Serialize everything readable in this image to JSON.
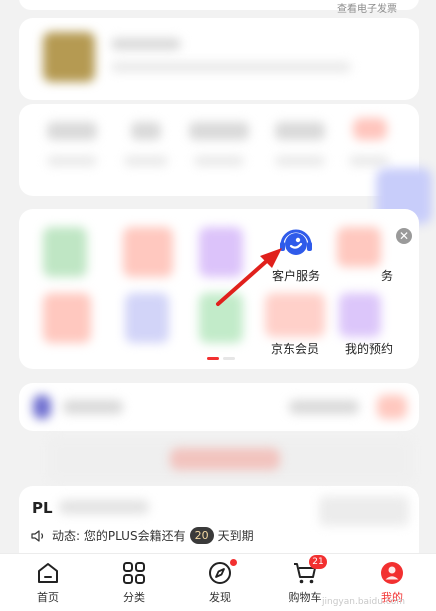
{
  "header": {
    "invoice_link": "查看电子发票"
  },
  "services": {
    "customer_service_label": "客户服务",
    "item_partial_right": "务",
    "vip_label": "京东会员",
    "reservation_label": "我的预约",
    "close_symbol": "✕"
  },
  "plus": {
    "title": "PL",
    "notice_prefix": "动态: 您的PLUS会籍还有",
    "days": "20",
    "notice_suffix": "天到期"
  },
  "tabbar": {
    "items": [
      {
        "label": "首页",
        "icon": "home-icon"
      },
      {
        "label": "分类",
        "icon": "grid-icon"
      },
      {
        "label": "发现",
        "icon": "compass-icon"
      },
      {
        "label": "购物车",
        "icon": "cart-icon",
        "badge": "21"
      },
      {
        "label": "我的",
        "icon": "avatar-icon"
      }
    ]
  },
  "watermark": "jingyan.baidu.com",
  "colors": {
    "accent": "#f23030",
    "icon_blue": "#2f5bea"
  }
}
